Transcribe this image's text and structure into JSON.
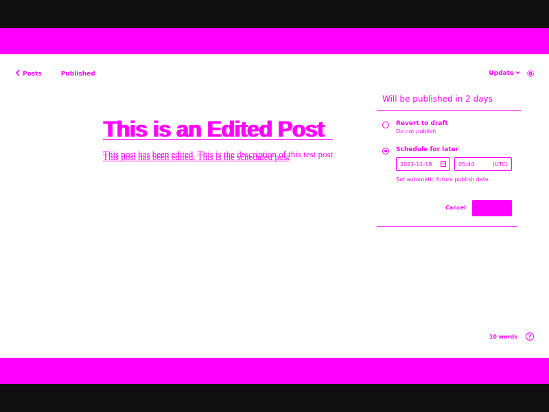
{
  "nav": {
    "back_label": "Posts",
    "status": "Published"
  },
  "actions": {
    "update_label": "Update"
  },
  "post": {
    "title": "This is an Edited Post",
    "title_overlay": "This is an Edited Post",
    "description": "This post has been edited. This is the description of this test post",
    "description_overlay": "This post has been edited. This is the scheduled post"
  },
  "popover": {
    "heading": "Will be published in 2 days",
    "revert_label": "Revert to draft",
    "revert_sub": "Do not publish",
    "schedule_label": "Schedule for later",
    "date_value": "2022-11-18",
    "time_value": "05:44",
    "timezone": "(UTC)",
    "hint": "Set automatic future publish date",
    "cancel_label": "Cancel",
    "schedule_button_label": ""
  },
  "footer": {
    "word_count": "10 words",
    "help_glyph": "?"
  },
  "colors": {
    "accent": "#ff00ff",
    "background": "#ffffff",
    "chrome": "#101010"
  },
  "icons": [
    "chevron-left-icon",
    "chevron-down-icon",
    "gear-icon",
    "calendar-icon",
    "help-icon"
  ]
}
